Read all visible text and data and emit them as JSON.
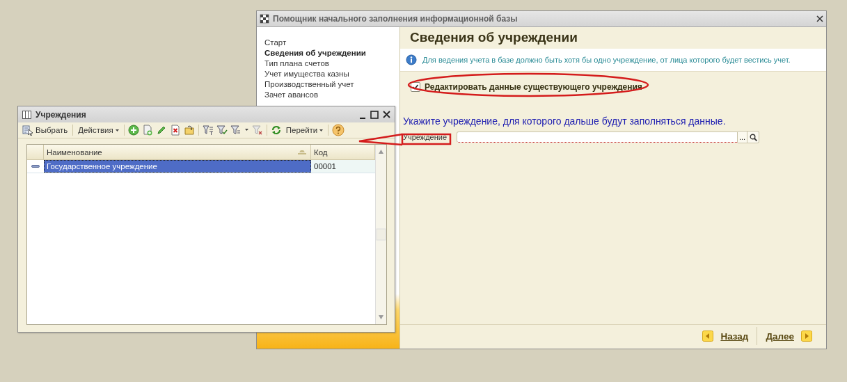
{
  "wizard": {
    "title": "Помощник начального заполнения информационной базы",
    "steps": [
      {
        "label": "Старт",
        "selected": false
      },
      {
        "label": "Сведения об учреждении",
        "selected": true
      },
      {
        "label": "Тип плана счетов",
        "selected": false
      },
      {
        "label": "Учет имущества казны",
        "selected": false
      },
      {
        "label": "Производственный учет",
        "selected": false
      },
      {
        "label": "Зачет авансов",
        "selected": false
      }
    ],
    "heading": "Сведения об учреждении",
    "info": "Для ведения учета в базе должно быть хотя бы одно учреждение, от лица которого будет вестись учет.",
    "checkbox": {
      "label": "Редактировать данные существующего учреждения",
      "checked": true
    },
    "prompt": "Укажите учреждение, для которого дальше будут заполняться данные.",
    "field": {
      "label": "Учреждение",
      "choice_button": "..."
    },
    "buttons": [
      {
        "label": "Назад",
        "kind": "back"
      },
      {
        "label": "Далее",
        "kind": "next"
      }
    ]
  },
  "catalog": {
    "title": "Учреждения",
    "toolbar": {
      "select": "Выбрать",
      "actions": "Действия",
      "goto": "Перейти"
    },
    "columns": [
      "Наименование",
      "Код"
    ],
    "rows": [
      {
        "cells": [
          "Государственное учреждение",
          "00001"
        ],
        "selected": true
      }
    ]
  }
}
